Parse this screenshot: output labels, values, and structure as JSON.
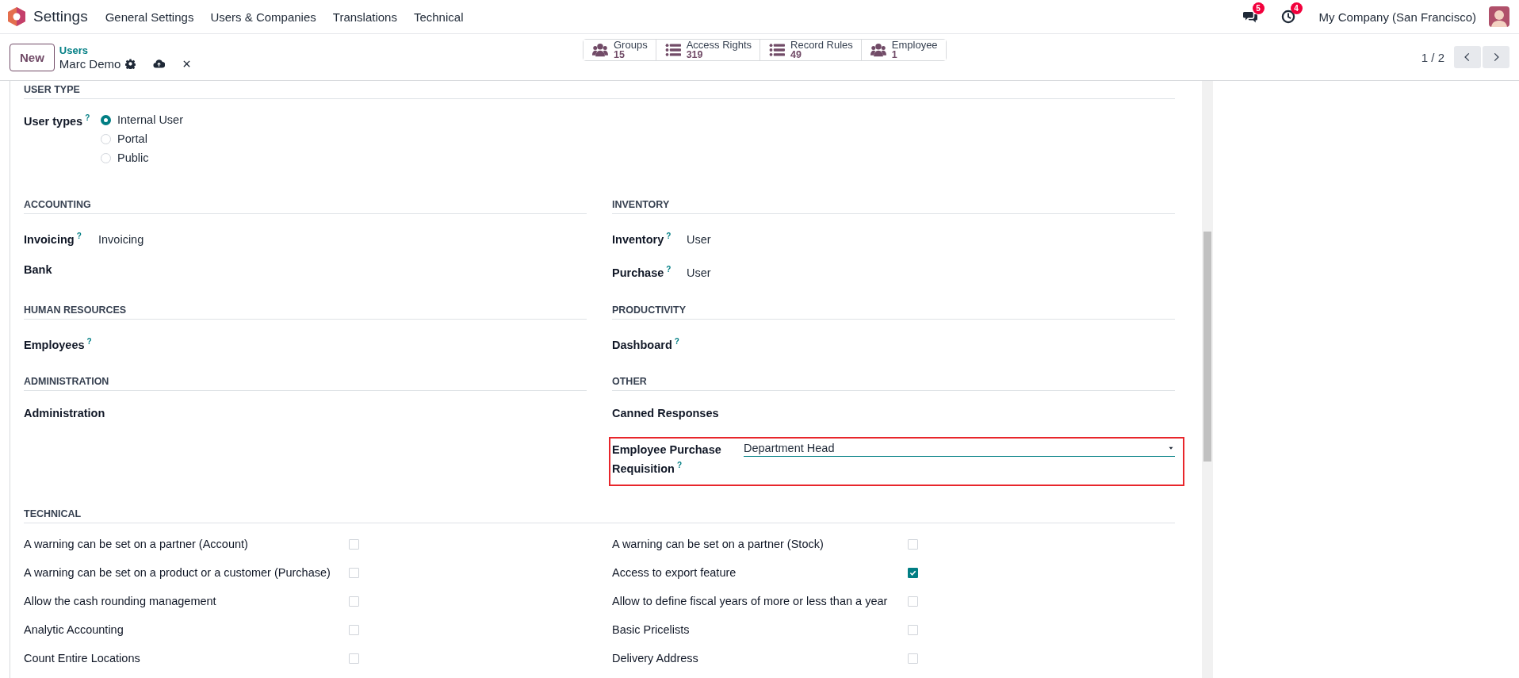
{
  "navbar": {
    "app": "Settings",
    "menu": [
      "General Settings",
      "Users & Companies",
      "Translations",
      "Technical"
    ],
    "messages_badge": "5",
    "activities_badge": "4",
    "company": "My Company (San Francisco)"
  },
  "control_panel": {
    "new_button": "New",
    "breadcrumb": "Users",
    "record_name": "Marc Demo",
    "smart_buttons": [
      {
        "kind": "users",
        "label": "Groups",
        "count": "15"
      },
      {
        "kind": "list",
        "label": "Access Rights",
        "count": "319"
      },
      {
        "kind": "list",
        "label": "Record Rules",
        "count": "49"
      },
      {
        "kind": "users",
        "label": "Employee",
        "count": "1"
      }
    ],
    "pager": "1 / 2"
  },
  "form": {
    "user_type": {
      "title": "USER TYPE",
      "label": "User types",
      "help": "?",
      "options": [
        {
          "label": "Internal User",
          "selected": true
        },
        {
          "label": "Portal",
          "selected": false
        },
        {
          "label": "Public",
          "selected": false
        }
      ]
    },
    "sections": [
      {
        "title": "ACCOUNTING",
        "fields": [
          {
            "kind": "text",
            "label": "Invoicing",
            "help": "?",
            "value": "Invoicing"
          },
          {
            "kind": "text",
            "label": "Bank"
          }
        ]
      },
      {
        "title": "INVENTORY",
        "fields": [
          {
            "kind": "text",
            "label": "Inventory",
            "help": "?",
            "value": "User"
          },
          {
            "kind": "text",
            "label": "Purchase",
            "help": "?",
            "value": "User"
          }
        ]
      },
      {
        "title": "HUMAN RESOURCES",
        "fields": [
          {
            "kind": "text",
            "label": "Employees",
            "help": "?"
          }
        ]
      },
      {
        "title": "PRODUCTIVITY",
        "fields": [
          {
            "kind": "text",
            "label": "Dashboard",
            "help": "?"
          }
        ]
      },
      {
        "title": "ADMINISTRATION",
        "fields": [
          {
            "kind": "text",
            "label": "Administration"
          }
        ]
      },
      {
        "title": "OTHER",
        "fields": [
          {
            "kind": "text",
            "label": "Canned Responses"
          },
          {
            "kind": "select",
            "label": "Employee Purchase Requisition",
            "help": "?",
            "value": "Department Head",
            "highlighted": true
          }
        ]
      }
    ],
    "technical": {
      "title": "TECHNICAL",
      "items": [
        {
          "label": "A warning can be set on a partner (Account)",
          "checked": false
        },
        {
          "label": "A warning can be set on a partner (Stock)",
          "checked": false
        },
        {
          "label": "A warning can be set on a product or a customer (Purchase)",
          "checked": false
        },
        {
          "label": "Access to export feature",
          "checked": true
        },
        {
          "label": "Allow the cash rounding management",
          "checked": false
        },
        {
          "label": "Allow to define fiscal years of more or less than a year",
          "checked": false
        },
        {
          "label": "Analytic Accounting",
          "checked": false
        },
        {
          "label": "Basic Pricelists",
          "checked": false
        },
        {
          "label": "Count Entire Locations",
          "checked": false
        },
        {
          "label": "Delivery Address",
          "checked": false
        }
      ]
    }
  }
}
